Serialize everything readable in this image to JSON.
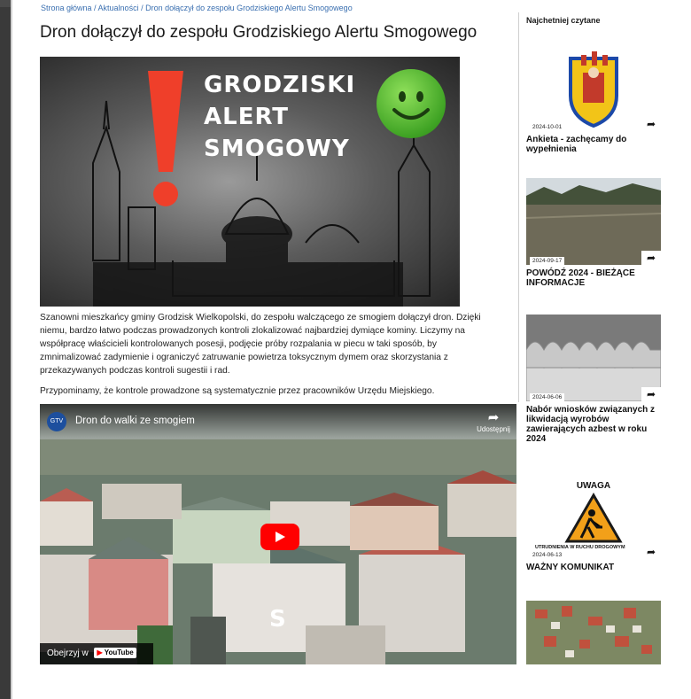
{
  "breadcrumb": "Strona główna / Aktualności / Dron dołączył do zespołu Grodziskiego Alertu Smogowego",
  "article": {
    "title": "Dron dołączył do zespołu Grodziskiego Alertu Smogowego",
    "hero_line1": "GRODZISKI",
    "hero_line2": "ALERT",
    "hero_line3": "SMOGOWY",
    "paragraph1": "Szanowni mieszkańcy gminy Grodzisk Wielkopolski, do zespołu walczącego ze smogiem dołączył dron. Dzięki niemu, bardzo łatwo podczas prowadzonych kontroli zlokalizować najbardziej dymiące kominy. Liczymy na współpracę właścicieli kontrolowanych posesji, podjęcie próby rozpalania w piecu w taki sposób, by zmnimalizować zadymienie i ograniczyć zatruwanie powietrza toksycznym dymem oraz skorzystania z przekazywanych podczas kontroli sugestii i rad.",
    "paragraph2": "Przypominamy, że kontrole prowadzone są systematycznie przez pracowników Urzędu Miejskiego."
  },
  "video": {
    "channel_logo": "GTV",
    "title": "Dron do walki ze smogiem",
    "share_label": "Udostępnij",
    "overlay_letter": "S",
    "watch_label": "Obejrzyj w",
    "youtube_label": "YouTube"
  },
  "sidebar": {
    "heading": "Najchetniej czytane",
    "items": [
      {
        "date": "2024-10-01",
        "title": "Ankieta - zachęcamy do wypełnienia",
        "thumb": "coat-of-arms"
      },
      {
        "date": "2024-09-17",
        "title": "POWÓDŹ 2024 - BIEŻĄCE INFORMACJE",
        "thumb": "flooded-river"
      },
      {
        "date": "2024-06-06",
        "title": "Nabór wniosków związanych z likwidacją wyrobów zawierających azbest w roku 2024",
        "thumb": "asbestos-sheets"
      },
      {
        "date": "2024-06-13",
        "title": "WAŻNY KOMUNIKAT",
        "thumb": "roadworks-sign",
        "thumb_heading": "UWAGA",
        "thumb_caption": "UTRUDNIENIA W RUCHU DROGOWYM"
      },
      {
        "date": "",
        "title": "",
        "thumb": "aerial-town"
      }
    ]
  },
  "colors": {
    "link": "#3a6fb0",
    "alert_red": "#ef3f2a",
    "smiley_green": "#4cb52c",
    "youtube_red": "#ff0000"
  }
}
